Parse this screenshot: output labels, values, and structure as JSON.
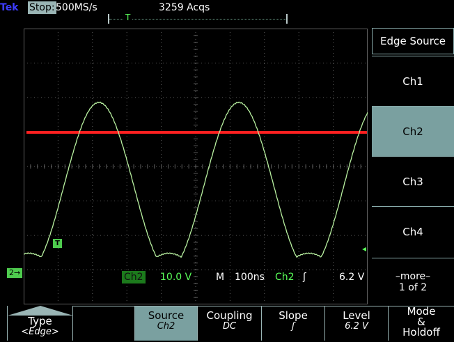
{
  "status": {
    "brand": "Tek",
    "state": "Stop:",
    "sample_rate": "500MS/s",
    "acquisitions": "3259 Acqs",
    "trigger_position_marker": "T"
  },
  "markers": {
    "trigger_marker": "T",
    "channel_marker": "2→",
    "level_arrow": "◂"
  },
  "readout": {
    "channel": "Ch2",
    "volts_per_div": "10.0 V",
    "m_label": "M",
    "time_per_div": "100ns",
    "trigger_channel": "Ch2",
    "slope_symbol": "ʃ",
    "trigger_level": "6.2 V"
  },
  "side_menu": {
    "title": "Edge Source",
    "items": [
      {
        "label": "Ch1",
        "selected": false
      },
      {
        "label": "Ch2",
        "selected": true
      },
      {
        "label": "Ch3",
        "selected": false
      },
      {
        "label": "Ch4",
        "selected": false
      }
    ],
    "more_line1": "–more–",
    "more_line2": "1 of 2"
  },
  "bottom_menu": {
    "type_label": "Type",
    "type_value": "<Edge>",
    "source_label": "Source",
    "source_value": "Ch2",
    "coupling_label": "Coupling",
    "coupling_value": "DC",
    "slope_label": "Slope",
    "slope_value": "ʃ",
    "level_label": "Level",
    "level_value": "6.2 V",
    "mode_line1": "Mode",
    "mode_line2": "&",
    "mode_line3": "Holdoff"
  },
  "colors": {
    "trace": "#b8f0a0",
    "trigger_level_line": "#ff2020",
    "grid": "#606060",
    "selected_menu": "#7aa0a0"
  }
}
